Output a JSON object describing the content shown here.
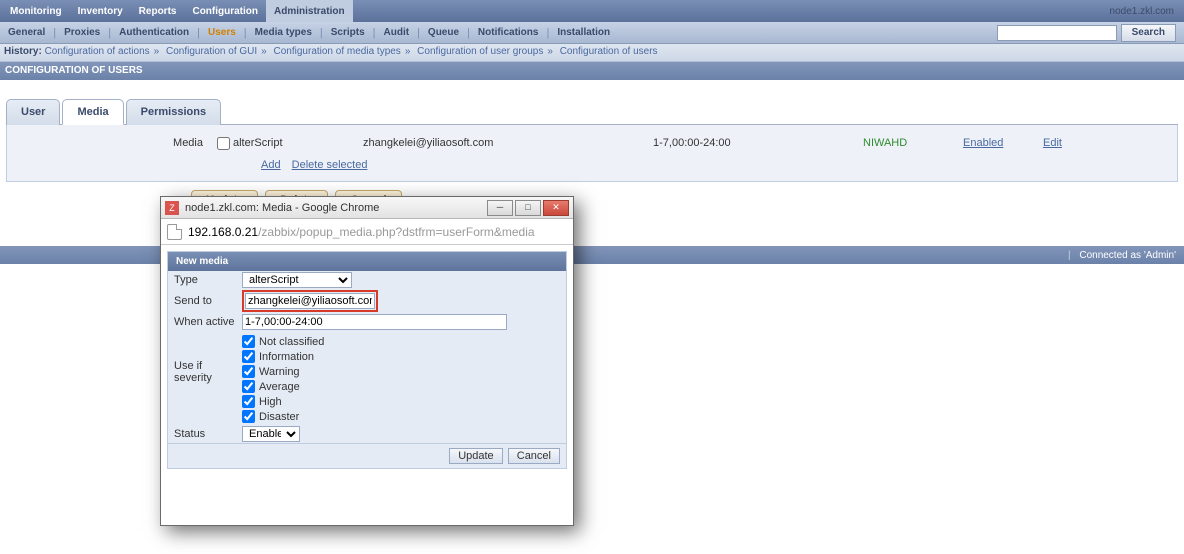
{
  "hostname": "node1.zkl.com",
  "topmenu": {
    "items": [
      "Monitoring",
      "Inventory",
      "Reports",
      "Configuration",
      "Administration"
    ],
    "active": 4
  },
  "submenu": {
    "items": [
      "General",
      "Proxies",
      "Authentication",
      "Users",
      "Media types",
      "Scripts",
      "Audit",
      "Queue",
      "Notifications",
      "Installation"
    ],
    "active": 3,
    "search_placeholder": "",
    "search_btn": "Search"
  },
  "history": {
    "label": "History:",
    "items": [
      "Configuration of actions",
      "Configuration of GUI",
      "Configuration of media types",
      "Configuration of user groups",
      "Configuration of users"
    ]
  },
  "pagetitle": "CONFIGURATION OF USERS",
  "tabs": {
    "items": [
      "User",
      "Media",
      "Permissions"
    ],
    "active": 1
  },
  "media": {
    "label": "Media",
    "row": {
      "type": "alterScript",
      "sendto": "zhangkelei@yiliaosoft.com",
      "when": "1-7,00:00-24:00",
      "severity": "NIWAHD",
      "status": "Enabled",
      "edit": "Edit"
    },
    "actions": {
      "add": "Add",
      "delsel": "Delete selected"
    }
  },
  "buttons": {
    "update": "Update",
    "delete": "Delete",
    "cancel": "Cancel"
  },
  "footer": {
    "connected": "Connected as 'Admin'"
  },
  "popup": {
    "wintitle": "node1.zkl.com: Media - Google Chrome",
    "urlhost": "192.168.0.21",
    "urlrest": "/zabbix/popup_media.php?dstfrm=userForm&media",
    "header": "New media",
    "labels": {
      "type": "Type",
      "sendto": "Send to",
      "when": "When active",
      "severity": "Use if severity",
      "status": "Status"
    },
    "type_value": "alterScript",
    "sendto_value": "zhangkelei@yiliaosoft.com",
    "when_value": "1-7,00:00-24:00",
    "severities": [
      "Not classified",
      "Information",
      "Warning",
      "Average",
      "High",
      "Disaster"
    ],
    "status_value": "Enabled",
    "buttons": {
      "update": "Update",
      "cancel": "Cancel"
    }
  }
}
